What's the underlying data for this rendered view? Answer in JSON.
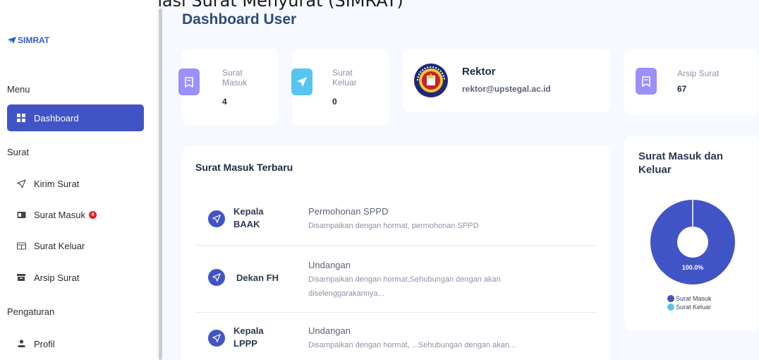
{
  "window_title": "Sistem Informasi Surat Menyurat (SIMRAT)",
  "sidebar": {
    "logo": "SIMRAT",
    "sections": [
      "Menu",
      "Surat",
      "Pengaturan"
    ],
    "items": [
      {
        "label": "Dashboard",
        "icon": "grid-icon",
        "active": true
      },
      {
        "label": "Kirim Surat",
        "icon": "send-icon"
      },
      {
        "label": "Surat Masuk",
        "icon": "inbox-icon",
        "badge": "4"
      },
      {
        "label": "Surat Keluar",
        "icon": "outbox-icon"
      },
      {
        "label": "Arsip Surat",
        "icon": "archive-icon"
      },
      {
        "label": "Profil",
        "icon": "user-icon"
      }
    ]
  },
  "page_title": "Dashboard User",
  "stats": [
    {
      "label_line1": "Surat",
      "label_line2": "Masuk",
      "value": "4",
      "color": "#9b8ffa",
      "icon": "bookmark-icon"
    },
    {
      "label_line1": "Surat",
      "label_line2": "Keluar",
      "value": "0",
      "color": "#57c5f0",
      "icon": "send-icon"
    },
    {
      "label_line1": "Arsip Surat",
      "value": "67",
      "color": "#9b8ffa",
      "icon": "bookmark-icon"
    }
  ],
  "profile": {
    "name": "Rektor",
    "email": "rektor@upstegal.ac.id",
    "logo": "university-seal"
  },
  "incoming": {
    "title": "Surat Masuk Terbaru",
    "items": [
      {
        "sender_line1": "Kepala",
        "sender_line2": "BAAK",
        "subject": "Permohonan SPPD",
        "preview": "Disampaikan dengan hormat, permohonan SPPD"
      },
      {
        "sender_line1": "Dekan FH",
        "sender_line2": "",
        "subject": "Undangan",
        "preview": "Disampaikan dengan hormat,Sehubungan dengan akan diselenggarakannya..."
      },
      {
        "sender_line1": "Kepala",
        "sender_line2": "LPPP",
        "subject": "Undangan",
        "preview": "Disampaikan dengan hormat, ...Sehubungan dengan akan..."
      }
    ]
  },
  "chart_data": {
    "type": "pie",
    "title": "Surat Masuk dan Keluar",
    "categories": [
      "Surat Masuk",
      "Surat Keluar"
    ],
    "values": [
      4,
      0
    ],
    "colors": [
      "#4154c6",
      "#57c5f0"
    ],
    "data_labels": [
      "100.0%"
    ],
    "legend_position": "bottom"
  }
}
